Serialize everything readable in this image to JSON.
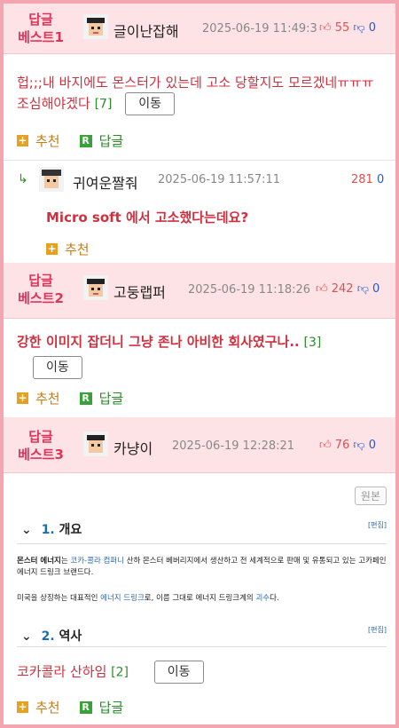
{
  "comments": [
    {
      "best_label": "답글\n베스트1",
      "author": "글이난잡해",
      "time": "2025-06-19 11:49:3",
      "up": "55",
      "down": "0",
      "text": "헙;;;내 바지에도 몬스터가 있는데 고소 당할지도 모르겠네ㅠㅠㅠ 조심해야겠다",
      "count": "[7]",
      "move_label": "이동",
      "recommend_label": "추천",
      "reply_label": "답글",
      "reply": {
        "author": "귀여운짤줘",
        "time": "2025-06-19 11:57:11",
        "up": "281",
        "down": "0",
        "text": "Micro soft 에서 고소했다는데요?",
        "recommend_label": "추천"
      }
    },
    {
      "best_label": "답글\n베스트2",
      "author": "고둥랩퍼",
      "time": "2025-06-19 11:18:26",
      "up": "242",
      "down": "0",
      "text": "강한 이미지 잡더니 그냥 존나 아비한 회사였구나..",
      "count": "[3]",
      "move_label": "이동",
      "recommend_label": "추천",
      "reply_label": "답글"
    },
    {
      "best_label": "답글\n베스트3",
      "author": "카냥이",
      "time": "2025-06-19 12:28:21",
      "up": "76",
      "down": "0",
      "wiki": {
        "wonbon_label": "원본",
        "edit_label": "[편집]",
        "s1_num": "1.",
        "s1_title": "개요",
        "p1_a": "몬스터 에너지",
        "p1_b": "는 ",
        "p1_link": "코카-콜라 컴퍼니",
        "p1_c": " 산하 몬스터 베버리지에서 생산하고 전 세계적으로 판매 및 유통되고 있는 고카페인 에너지 드링크 브랜드다.",
        "p2_a": "미국을 상징하는 대표적인 ",
        "p2_link1": "에너지 드링크",
        "p2_b": "로, 이름 그대로 에너지 드링크계의 ",
        "p2_link2": "괴수",
        "p2_c": "다.",
        "s2_num": "2.",
        "s2_title": "역사"
      },
      "text": "코카콜라 산하임",
      "count": "[2]",
      "move_label": "이동",
      "recommend_label": "추천",
      "reply_label": "답글"
    }
  ],
  "icons": {
    "thumb_up": "thumb-up-icon",
    "thumb_down": "thumb-down-icon",
    "reply_arrow": "reply-arrow-icon",
    "chevron": "chevron-down-icon"
  }
}
